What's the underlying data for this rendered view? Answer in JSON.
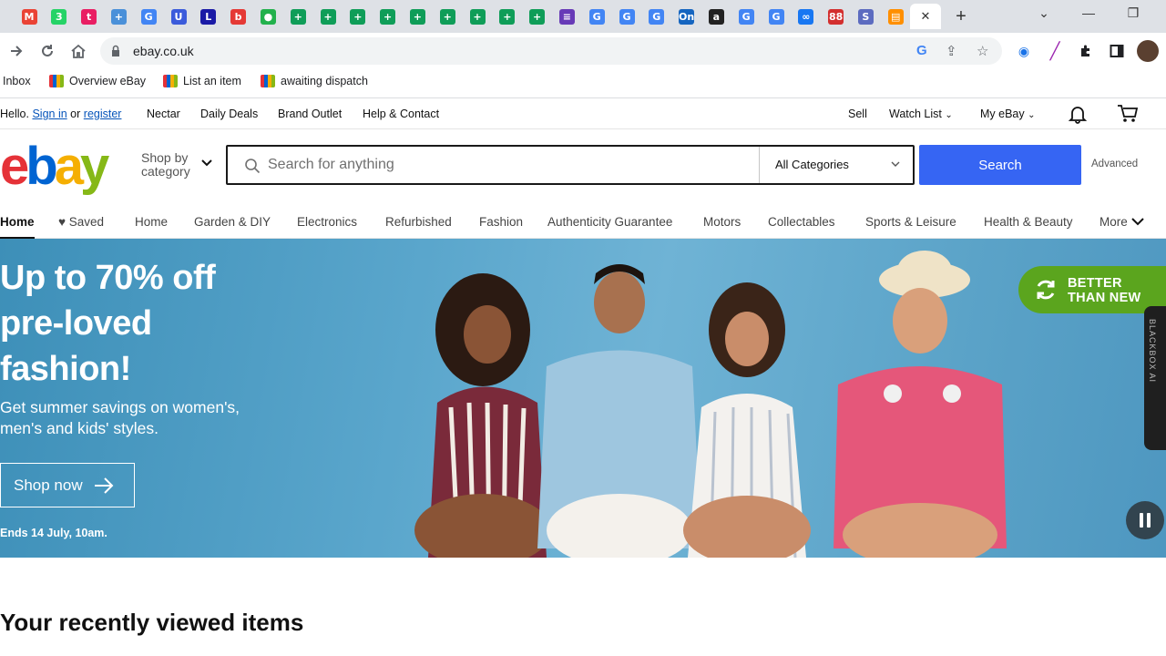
{
  "browser": {
    "tabs": [
      {
        "icon": "gmail-icon",
        "color": "#ea4335",
        "glyph": "M"
      },
      {
        "icon": "whatsapp-icon",
        "color": "#25d366",
        "glyph": "3"
      },
      {
        "icon": "tab-icon",
        "color": "#e91e63",
        "glyph": "t"
      },
      {
        "icon": "tab-icon",
        "color": "#4a90d9",
        "glyph": "+"
      },
      {
        "icon": "google-icon",
        "color": "#4285f4",
        "glyph": "G"
      },
      {
        "icon": "tab-icon",
        "color": "#3b5bdb",
        "glyph": "U"
      },
      {
        "icon": "tab-icon",
        "color": "#1a1aa6",
        "glyph": "L"
      },
      {
        "icon": "tab-icon",
        "color": "#e53935",
        "glyph": "b"
      },
      {
        "icon": "tab-icon",
        "color": "#22b14c",
        "glyph": "●"
      },
      {
        "icon": "sheets-icon",
        "color": "#0f9d58",
        "glyph": "+"
      },
      {
        "icon": "sheets-icon",
        "color": "#0f9d58",
        "glyph": "+"
      },
      {
        "icon": "sheets-icon",
        "color": "#0f9d58",
        "glyph": "+"
      },
      {
        "icon": "sheets-icon",
        "color": "#0f9d58",
        "glyph": "+"
      },
      {
        "icon": "sheets-icon",
        "color": "#0f9d58",
        "glyph": "+"
      },
      {
        "icon": "sheets-icon",
        "color": "#0f9d58",
        "glyph": "+"
      },
      {
        "icon": "sheets-icon",
        "color": "#0f9d58",
        "glyph": "+"
      },
      {
        "icon": "sheets-icon",
        "color": "#0f9d58",
        "glyph": "+"
      },
      {
        "icon": "sheets-icon",
        "color": "#0f9d58",
        "glyph": "+"
      },
      {
        "icon": "forms-icon",
        "color": "#673ab7",
        "glyph": "≡"
      },
      {
        "icon": "google-icon",
        "color": "#4285f4",
        "glyph": "G"
      },
      {
        "icon": "google-icon",
        "color": "#4285f4",
        "glyph": "G"
      },
      {
        "icon": "google-icon",
        "color": "#4285f4",
        "glyph": "G"
      },
      {
        "icon": "tab-icon",
        "color": "#1565c0",
        "glyph": "On"
      },
      {
        "icon": "amazon-icon",
        "color": "#222222",
        "glyph": "a"
      },
      {
        "icon": "google-icon",
        "color": "#4285f4",
        "glyph": "G"
      },
      {
        "icon": "google-icon",
        "color": "#4285f4",
        "glyph": "G"
      },
      {
        "icon": "meta-icon",
        "color": "#1877f2",
        "glyph": "∞"
      },
      {
        "icon": "tab-icon",
        "color": "#d32f2f",
        "glyph": "88"
      },
      {
        "icon": "tab-icon",
        "color": "#5c6bc0",
        "glyph": "S"
      },
      {
        "icon": "tab-icon",
        "color": "#ff8f00",
        "glyph": "▤"
      },
      {
        "icon": "close-icon",
        "color": "#333333",
        "glyph": "✕",
        "active": true
      }
    ],
    "url": "ebay.co.uk",
    "bookmarks": [
      {
        "label": "Inbox",
        "color": ""
      },
      {
        "label": "Overview eBay",
        "color": "#e53238"
      },
      {
        "label": "List an item",
        "color": "#0064d2"
      },
      {
        "label": "awaiting dispatch",
        "color": "#0064d2"
      }
    ]
  },
  "ebay": {
    "top": {
      "hello": "Hello.",
      "sign_in": "Sign in",
      "or": "or",
      "register": "register",
      "links": [
        "Nectar",
        "Daily Deals",
        "Brand Outlet",
        "Help & Contact"
      ],
      "sell": "Sell",
      "watch_list": "Watch List",
      "my_ebay": "My eBay"
    },
    "shop_by_1": "Shop by",
    "shop_by_2": "category",
    "search_placeholder": "Search for anything",
    "category_select": "All Categories",
    "search_button": "Search",
    "advanced": "Advanced",
    "nav": [
      "Home",
      "Saved",
      "Home",
      "Garden & DIY",
      "Electronics",
      "Refurbished",
      "Fashion",
      "Authenticity Guarantee",
      "Motors",
      "Collectables",
      "Sports & Leisure",
      "Health & Beauty",
      "More"
    ],
    "hero": {
      "title": "Up to 70% off pre-loved fashion!",
      "subtitle": "Get summer savings on women's, men's and kids' styles.",
      "cta": "Shop now",
      "ends": "Ends 14 July, 10am.",
      "badge_line1": "BETTER",
      "badge_line2": "THAN NEW",
      "blackbox": "BLACKBOX AI"
    },
    "recent_heading": "Your recently viewed items"
  }
}
